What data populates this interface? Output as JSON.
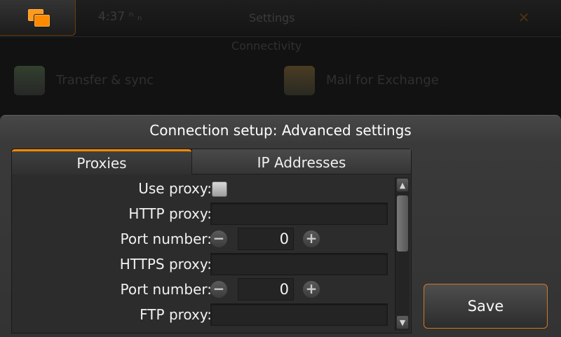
{
  "background": {
    "status_left": "4:37 ⁿ ₙ",
    "title": "Settings",
    "section": "Connectivity",
    "applets": [
      {
        "label": "Transfer & sync"
      },
      {
        "label": "Mail for Exchange"
      }
    ]
  },
  "dialog": {
    "title": "Connection setup: Advanced settings",
    "tabs": [
      {
        "label": "Proxies",
        "active": true
      },
      {
        "label": "IP Addresses",
        "active": false
      }
    ],
    "rows": {
      "use_proxy": {
        "label": "Use proxy:",
        "checked": false
      },
      "http_proxy": {
        "label": "HTTP proxy:",
        "value": ""
      },
      "http_port": {
        "label": "Port number:",
        "value": "0"
      },
      "https_proxy": {
        "label": "HTTPS proxy:",
        "value": ""
      },
      "https_port": {
        "label": "Port number:",
        "value": "0"
      },
      "ftp_proxy": {
        "label": "FTP proxy:",
        "value": ""
      }
    },
    "save_label": "Save"
  },
  "colors": {
    "accent": "#ff8a00",
    "dialog_bg": "#3a3a3a",
    "field_bg": "#242424"
  },
  "icons": {
    "task_switcher": "task-switcher-icon",
    "close": "close-icon",
    "minus": "minus-icon",
    "plus": "plus-icon",
    "scroll_up": "chevron-up-icon",
    "scroll_down": "chevron-down-icon"
  }
}
